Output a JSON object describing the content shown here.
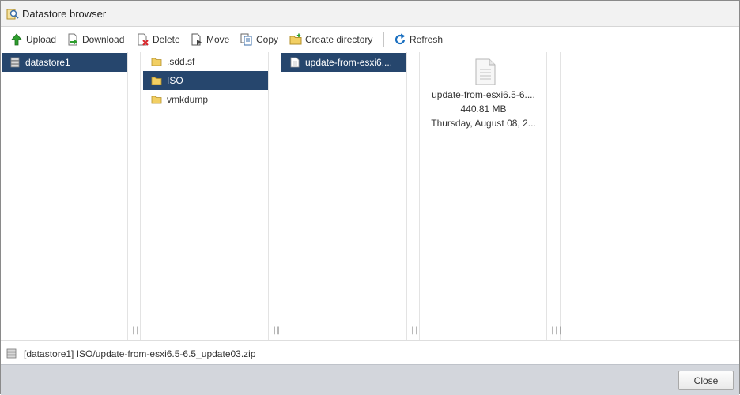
{
  "window": {
    "title": "Datastore browser"
  },
  "toolbar": {
    "upload": "Upload",
    "download": "Download",
    "delete": "Delete",
    "move": "Move",
    "copy": "Copy",
    "create_directory": "Create directory",
    "refresh": "Refresh"
  },
  "columns": {
    "datastores": [
      {
        "label": "datastore1",
        "selected": true
      }
    ],
    "folders": [
      {
        "label": ".sdd.sf",
        "selected": false
      },
      {
        "label": "ISO",
        "selected": true
      },
      {
        "label": "vmkdump",
        "selected": false
      }
    ],
    "files": [
      {
        "label": "update-from-esxi6....",
        "selected": true
      }
    ]
  },
  "details": {
    "name": "update-from-esxi6.5-6....",
    "size": "440.81 MB",
    "modified": "Thursday, August 08, 2..."
  },
  "grip_glyph": "|||",
  "status": {
    "path": "[datastore1] ISO/update-from-esxi6.5-6.5_update03.zip"
  },
  "footer": {
    "close_label": "Close"
  },
  "colors": {
    "selection": "#26466d",
    "footer": "#d3d6dc",
    "upload_icon": "#2e9e2e",
    "refresh_icon": "#1a6fc0",
    "folder_icon": "#f2cf63",
    "delete_icon": "#d9262c"
  },
  "icons": {
    "title": "datastore-browser-icon",
    "upload": "upload-arrow-icon",
    "download": "download-icon",
    "delete": "delete-icon",
    "move": "move-icon",
    "copy": "copy-icon",
    "create_directory": "new-folder-icon",
    "refresh": "refresh-icon",
    "datastore": "datastore-icon",
    "folder": "folder-icon",
    "file": "file-icon"
  }
}
